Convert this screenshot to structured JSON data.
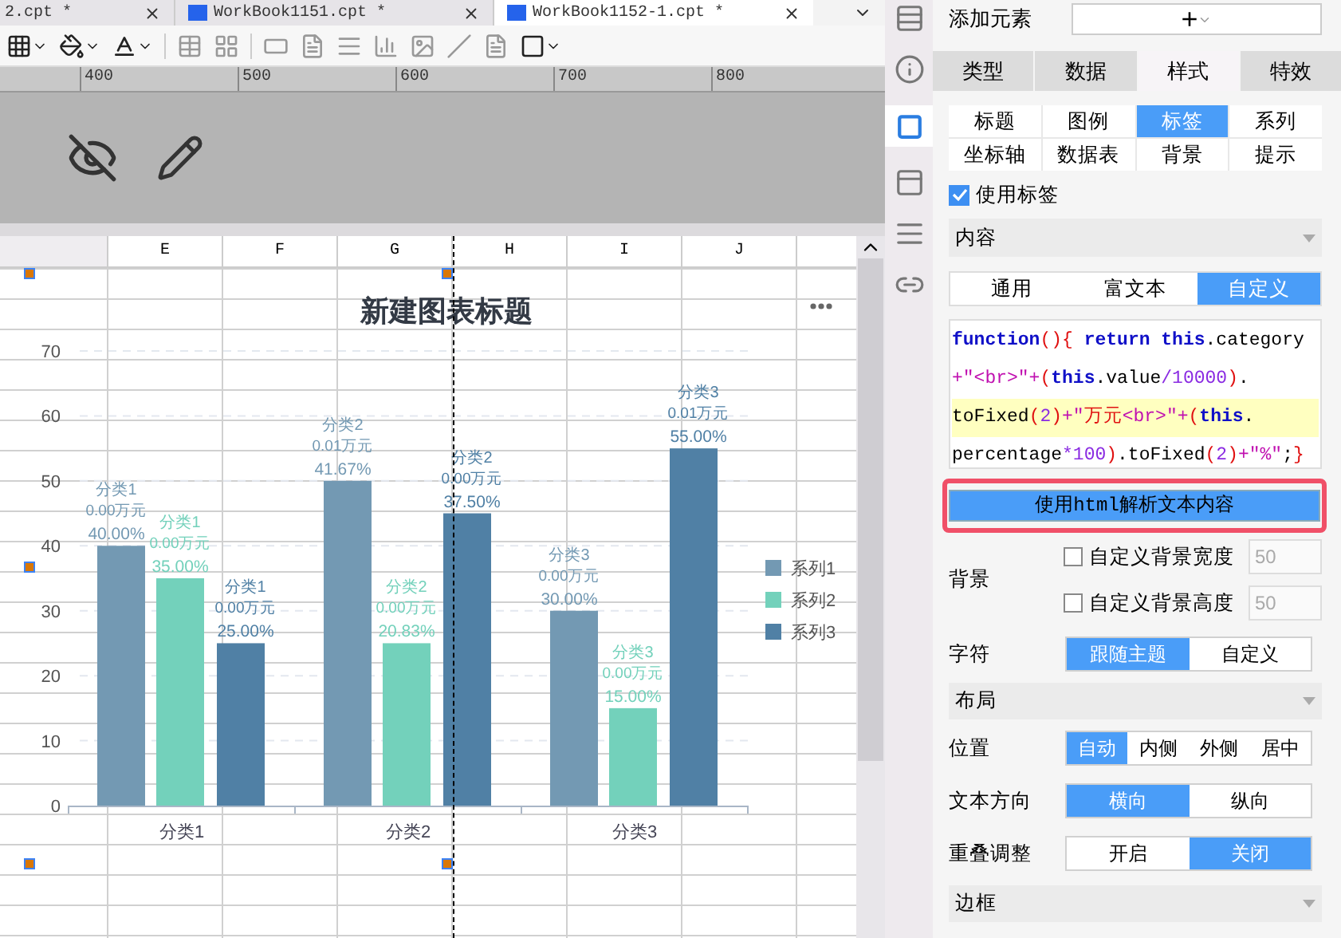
{
  "file_tabs": [
    {
      "label": "2.cpt *",
      "selected": false,
      "icon": false
    },
    {
      "label": "WorkBook1151.cpt *",
      "selected": false,
      "icon": true
    },
    {
      "label": "WorkBook1152-1.cpt *",
      "selected": true,
      "icon": true
    }
  ],
  "ruler": [
    "400",
    "500",
    "600",
    "700",
    "800"
  ],
  "columns": [
    "E",
    "F",
    "G",
    "H",
    "I",
    "J"
  ],
  "chart": {
    "title": "新建图表标题",
    "chart_data": {
      "type": "bar",
      "grid": true,
      "legend": "right",
      "categories": [
        "分类1",
        "分类2",
        "分类3"
      ],
      "ylim": [
        0,
        70
      ],
      "yticks": [
        0,
        10,
        20,
        30,
        40,
        50,
        60,
        70
      ],
      "series": [
        {
          "name": "系列1",
          "color": "#7399b3",
          "values": [
            40,
            50,
            30
          ]
        },
        {
          "name": "系列2",
          "color": "#73d1bb",
          "values": [
            35,
            25,
            15
          ]
        },
        {
          "name": "系列3",
          "color": "#5080a5",
          "values": [
            25,
            45,
            55
          ]
        }
      ],
      "value_labels": [
        [
          [
            "分类1",
            "0.00万元",
            "40.00%"
          ],
          [
            "分类2",
            "0.01万元",
            "41.67%"
          ],
          [
            "分类3",
            "0.00万元",
            "30.00%"
          ]
        ],
        [
          [
            "分类1",
            "0.00万元",
            "35.00%"
          ],
          [
            "分类2",
            "0.00万元",
            "20.83%"
          ],
          [
            "分类3",
            "0.00万元",
            "15.00%"
          ]
        ],
        [
          [
            "分类1",
            "0.00万元",
            "25.00%"
          ],
          [
            "分类2",
            "0.00万元",
            "37.50%"
          ],
          [
            "分类3",
            "0.01万元",
            "55.00%"
          ]
        ]
      ]
    }
  },
  "panel": {
    "add_element": {
      "label": "添加元素",
      "button": "+"
    },
    "tabs": [
      {
        "label": "类型",
        "selected": false
      },
      {
        "label": "数据",
        "selected": false
      },
      {
        "label": "样式",
        "selected": true
      },
      {
        "label": "特效",
        "selected": false
      }
    ],
    "subtabs": [
      {
        "label": "标题",
        "selected": false
      },
      {
        "label": "图例",
        "selected": false
      },
      {
        "label": "标签",
        "selected": true
      },
      {
        "label": "系列",
        "selected": false
      },
      {
        "label": "坐标轴",
        "selected": false
      },
      {
        "label": "数据表",
        "selected": false
      },
      {
        "label": "背景",
        "selected": false
      },
      {
        "label": "提示",
        "selected": false
      }
    ],
    "use_labels": {
      "label": "使用标签",
      "checked": true
    },
    "content_section": "内容",
    "content_modes": [
      {
        "label": "通用",
        "selected": false
      },
      {
        "label": "富文本",
        "selected": false
      },
      {
        "label": "自定义",
        "selected": true
      }
    ],
    "code_lines": [
      {
        "highlighted": false,
        "tokens": [
          {
            "kind": "kw",
            "text": "function"
          },
          {
            "kind": "paren",
            "text": "(){"
          },
          {
            "kind": "kw",
            "text": " return"
          },
          {
            "kind": "kw",
            "text": " this"
          },
          {
            "kind": "plain",
            "text": ".category"
          }
        ]
      },
      {
        "highlighted": false,
        "tokens": [
          {
            "kind": "str",
            "text": "+\"<br>\"+"
          },
          {
            "kind": "paren",
            "text": "("
          },
          {
            "kind": "kw",
            "text": "this"
          },
          {
            "kind": "plain",
            "text": ".value"
          },
          {
            "kind": "num",
            "text": "/10000"
          },
          {
            "kind": "paren",
            "text": ")"
          },
          {
            "kind": "plain",
            "text": "."
          }
        ]
      },
      {
        "highlighted": true,
        "tokens": [
          {
            "kind": "plain",
            "text": "toFixed"
          },
          {
            "kind": "paren",
            "text": "("
          },
          {
            "kind": "num",
            "text": "2"
          },
          {
            "kind": "paren",
            "text": ")"
          },
          {
            "kind": "str",
            "text": "+\""
          },
          {
            "kind": "paren",
            "text": "万元"
          },
          {
            "kind": "str",
            "text": "<br>\"+"
          },
          {
            "kind": "paren",
            "text": "("
          },
          {
            "kind": "kw",
            "text": "this"
          },
          {
            "kind": "plain",
            "text": "."
          }
        ]
      },
      {
        "highlighted": false,
        "tokens": [
          {
            "kind": "plain",
            "text": "percentage"
          },
          {
            "kind": "num",
            "text": "*100"
          },
          {
            "kind": "paren",
            "text": ")"
          },
          {
            "kind": "plain",
            "text": ".toFixed"
          },
          {
            "kind": "paren",
            "text": "("
          },
          {
            "kind": "num",
            "text": "2"
          },
          {
            "kind": "paren",
            "text": ")"
          },
          {
            "kind": "str",
            "text": "+\"%\""
          },
          {
            "kind": "plain",
            "text": ";"
          },
          {
            "kind": "paren",
            "text": "}"
          }
        ]
      }
    ],
    "html_button": "使用html解析文本内容",
    "background_label": "背景",
    "bg_options": [
      {
        "label": "自定义背景宽度",
        "checked": false,
        "value": "50",
        "disabled": true
      },
      {
        "label": "自定义背景高度",
        "checked": false,
        "value": "50",
        "disabled": true
      }
    ],
    "font_row": {
      "label": "字符",
      "options": [
        {
          "label": "跟随主题",
          "selected": true
        },
        {
          "label": "自定义",
          "selected": false
        }
      ]
    },
    "layout_section": "布局",
    "layout_rows": [
      {
        "label": "位置",
        "options": [
          {
            "label": "自动",
            "selected": true
          },
          {
            "label": "内侧",
            "selected": false
          },
          {
            "label": "外侧",
            "selected": false
          },
          {
            "label": "居中",
            "selected": false
          }
        ]
      },
      {
        "label": "文本方向",
        "options": [
          {
            "label": "横向",
            "selected": true
          },
          {
            "label": "纵向",
            "selected": false
          }
        ]
      },
      {
        "label": "重叠调整",
        "options": [
          {
            "label": "开启",
            "selected": false
          },
          {
            "label": "关闭",
            "selected": true
          }
        ]
      }
    ],
    "border_section": "边框"
  }
}
